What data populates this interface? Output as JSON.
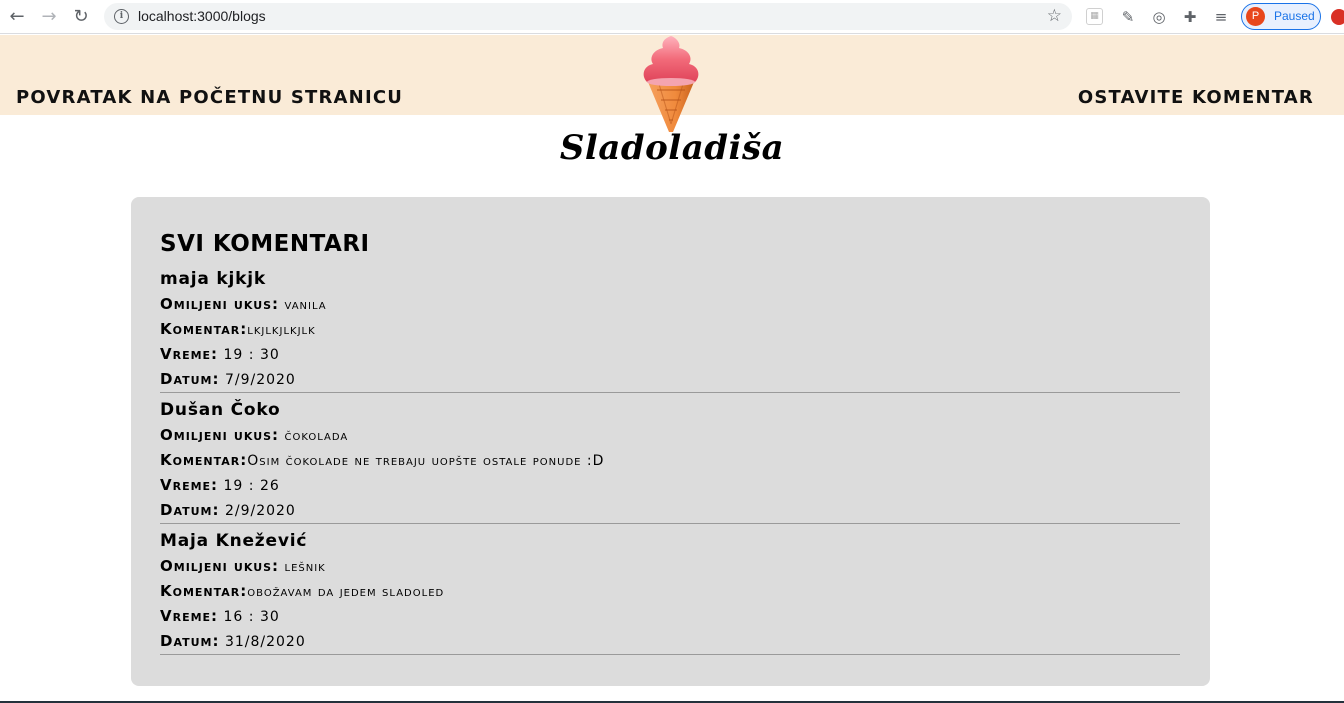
{
  "browser": {
    "url": "localhost:3000/blogs",
    "profile_initial": "P",
    "profile_status": "Paused"
  },
  "header": {
    "left_link": "POVRATAK NA POČETNU STRANICU",
    "right_link": "OSTAVITE KOMENTAR",
    "brand": "Sladoladiša"
  },
  "comments_section": {
    "title": "SVI KOMENTARI",
    "labels": {
      "flavor": "Omiljeni ukus:",
      "comment": "Komentar:",
      "time": "Vreme:",
      "date": "Datum:"
    },
    "items": [
      {
        "name": "maja kjkjk",
        "flavor": "vanila",
        "comment": "lkjlkjlkjlk",
        "time": "19 : 30",
        "date": "7/9/2020"
      },
      {
        "name": "Dušan Čoko",
        "flavor": "čokolada",
        "comment": "Osim čokolade ne trebaju uopšte ostale ponude :D",
        "time": "19 : 26",
        "date": "2/9/2020"
      },
      {
        "name": "Maja Knežević",
        "flavor": "lešnik",
        "comment": "obožavam da jedem sladoled",
        "time": "16 : 30",
        "date": "31/8/2020"
      }
    ]
  },
  "colors": {
    "header_bg": "#faebd7",
    "card_bg": "#dcdcdc",
    "ice_cream_top": "#f26b7a",
    "cone": "#f08a3c"
  }
}
